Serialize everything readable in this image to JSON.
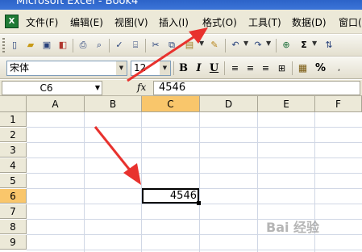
{
  "window": {
    "title": "Microsoft Excel - Book4"
  },
  "menu": {
    "items": [
      "文件(F)",
      "编辑(E)",
      "视图(V)",
      "插入(I)",
      "格式(O)",
      "工具(T)",
      "数据(D)",
      "窗口("
    ]
  },
  "toolbar_format": {
    "font": "宋体",
    "size": "12",
    "bold": "B",
    "italic": "I",
    "underline": "U",
    "percent": "%"
  },
  "formula_bar": {
    "name_box": "C6",
    "fx_label": "fx",
    "content": "4546"
  },
  "grid": {
    "columns": [
      "A",
      "B",
      "C",
      "D",
      "E",
      "F"
    ],
    "rows": [
      "1",
      "2",
      "3",
      "4",
      "5",
      "6",
      "7",
      "8",
      "9"
    ],
    "active_column": "C",
    "active_row": "6",
    "active_cell_value": "4546"
  },
  "watermark": "Bai 经验",
  "colors": {
    "arrow": "#e8322e",
    "active_header": "#f9c66b",
    "title_bar": "#2c63c8"
  }
}
